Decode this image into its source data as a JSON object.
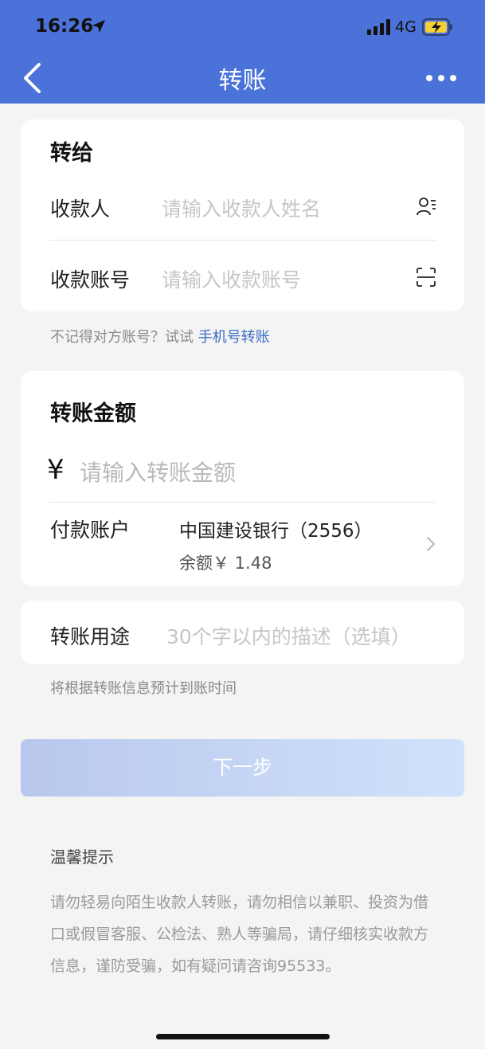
{
  "status_bar": {
    "time": "16:26",
    "network": "4G",
    "icons": [
      "location-arrow-icon",
      "signal-bars-icon",
      "battery-charging-icon"
    ]
  },
  "nav": {
    "title": "转账",
    "back_icon": "chevron-left-icon",
    "more_icon": "ellipsis-icon"
  },
  "payee_section": {
    "title": "转给",
    "payee": {
      "label": "收款人",
      "placeholder": "请输入收款人姓名",
      "icon": "contacts-icon"
    },
    "account": {
      "label": "收款账号",
      "placeholder": "请输入收款账号",
      "icon": "scan-icon"
    }
  },
  "phone_hint": {
    "text": "不记得对方账号？试试",
    "link": "手机号转账"
  },
  "amount_section": {
    "title": "转账金额",
    "currency": "¥",
    "placeholder": "请输入转账金额",
    "pay_account": {
      "label": "付款账户",
      "bank": "中国建设银行（2556）",
      "balance": "余额￥ 1.48"
    }
  },
  "purpose_section": {
    "label": "转账用途",
    "placeholder": "30个字以内的描述（选填）"
  },
  "arrival_hint": "将根据转账信息预计到账时间",
  "next_button": "下一步",
  "tips": {
    "title": "温馨提示",
    "body": "请勿轻易向陌生收款人转账，请勿相信以兼职、投资为借口或假冒客服、公检法、熟人等骗局，请仔细核实收款方信息，谨防受骗，如有疑问请咨询95533。"
  },
  "colors": {
    "header": "#4a72d9",
    "link": "#3f6cc9",
    "background": "#f4f4f4"
  }
}
